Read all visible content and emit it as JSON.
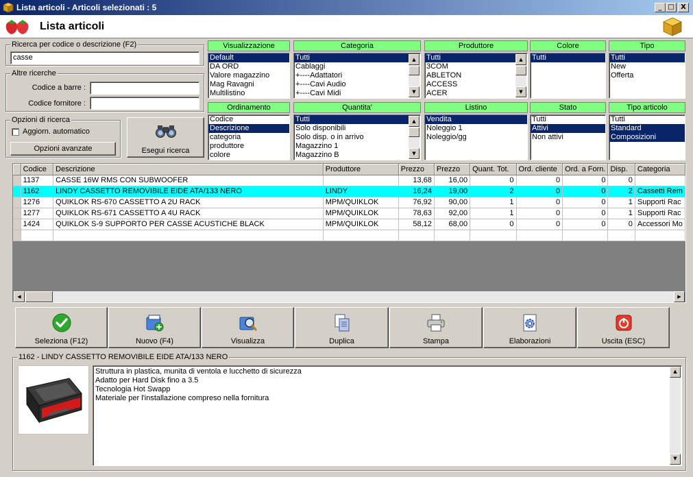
{
  "window": {
    "title": "Lista articoli - Articoli selezionati : 5",
    "minimize": "_",
    "maximize": "□",
    "close": "X"
  },
  "header": {
    "title": "Lista articoli"
  },
  "search": {
    "label": "Ricerca per codice o descrizione (F2)",
    "value": "casse"
  },
  "other_search": {
    "label": "Altre ricerche",
    "barcode_label": "Codice a barre :",
    "barcode_value": "",
    "supplier_label": "Codice fornitore :",
    "supplier_value": ""
  },
  "options": {
    "label": "Opzioni di ricerca",
    "auto_update": "Aggiorn. automatico",
    "advanced": "Opzioni avanzate"
  },
  "run_search": "Esegui ricerca",
  "filters": {
    "visualizzazione": {
      "title": "Visualizzazione",
      "items": [
        "Default",
        "DA ORD",
        "Valore magazzino",
        "Mag Ravagni",
        "Multilistino"
      ],
      "selected": [
        0
      ]
    },
    "categoria": {
      "title": "Categoria",
      "items": [
        "Tutti",
        "Cablaggi",
        "+----Adattatori",
        "+----Cavi Audio",
        "+----Cavi Midi"
      ],
      "selected": [
        0
      ]
    },
    "produttore": {
      "title": "Produttore",
      "items": [
        "Tutti",
        "3COM",
        "ABLETON",
        "ACCESS",
        "ACER"
      ],
      "selected": [
        0
      ]
    },
    "colore": {
      "title": "Colore",
      "items": [
        "Tutti"
      ],
      "selected": [
        0
      ]
    },
    "tipo": {
      "title": "Tipo",
      "items": [
        "Tutti",
        "New",
        "Offerta"
      ],
      "selected": [
        0
      ]
    },
    "ordinamento": {
      "title": "Ordinamento",
      "items": [
        "Codice",
        "Descrizione",
        "categoria",
        "produttore",
        "colore"
      ],
      "selected": [
        1
      ]
    },
    "quantita": {
      "title": "Quantita'",
      "items": [
        "Tutti",
        "Solo disponibili",
        "Solo disp. o in arrivo",
        "Magazzino 1",
        "Magazzino B"
      ],
      "selected": [
        0
      ]
    },
    "listino": {
      "title": "Listino",
      "items": [
        "Vendita",
        "Noleggio 1",
        "Noleggio/gg"
      ],
      "selected": [
        0
      ]
    },
    "stato": {
      "title": "Stato",
      "items": [
        "Tutti",
        "Attivi",
        "Non attivi"
      ],
      "selected": [
        1
      ]
    },
    "tipo_articolo": {
      "title": "Tipo articolo",
      "items": [
        "Tutti",
        "Standard",
        "Composizioni"
      ],
      "selected": [
        1,
        2
      ]
    }
  },
  "grid": {
    "columns": [
      "Codice",
      "Descrizione",
      "Produttore",
      "Prezzo",
      "Prezzo",
      "Quant. Tot.",
      "Ord. cliente",
      "Ord. a Forn.",
      "Disp.",
      "Categoria"
    ],
    "rows": [
      [
        "1137",
        "CASSE 16W RMS CON SUBWOOFER",
        "",
        "13,68",
        "16,00",
        "0",
        "0",
        "0",
        "0",
        ""
      ],
      [
        "1162",
        "LINDY CASSETTO REMOVIBILE EIDE  ATA/133 NERO",
        "LINDY",
        "16,24",
        "19,00",
        "2",
        "0",
        "0",
        "2",
        "Cassetti Rem"
      ],
      [
        "1276",
        "QUIKLOK RS-670 CASSETTO A 2U RACK",
        "MPM/QUIKLOK",
        "76,92",
        "90,00",
        "1",
        "0",
        "0",
        "1",
        "Supporti Rac"
      ],
      [
        "1277",
        "QUIKLOK RS-671 CASSETTO A 4U RACK",
        "MPM/QUIKLOK",
        "78,63",
        "92,00",
        "1",
        "0",
        "0",
        "1",
        "Supporti Rac"
      ],
      [
        "1424",
        "QUIKLOK S-9 SUPPORTO PER CASSE ACUSTICHE BLACK",
        "MPM/QUIKLOK",
        "58,12",
        "68,00",
        "0",
        "0",
        "0",
        "0",
        "Accessori Mo"
      ]
    ],
    "highlighted_row": 1
  },
  "toolbar": {
    "select": "Seleziona (F12)",
    "new": "Nuovo (F4)",
    "view": "Visualizza",
    "duplicate": "Duplica",
    "print": "Stampa",
    "processing": "Elaborazioni",
    "exit": "Uscita (ESC)"
  },
  "detail": {
    "title": "1162 - LINDY CASSETTO REMOVIBILE EIDE  ATA/133 NERO",
    "lines": [
      "Struttura in plastica, munita di ventola e lucchetto di sicurezza",
      "Adatto per Hard Disk fino a 3.5",
      "Tecnologia Hot Swapp",
      "Materiale per l'installazione compreso nella fornitura"
    ]
  },
  "colors": {
    "filter_header": "#80ff80",
    "highlight_row": "#00ffff",
    "selection": "#0a246a"
  }
}
